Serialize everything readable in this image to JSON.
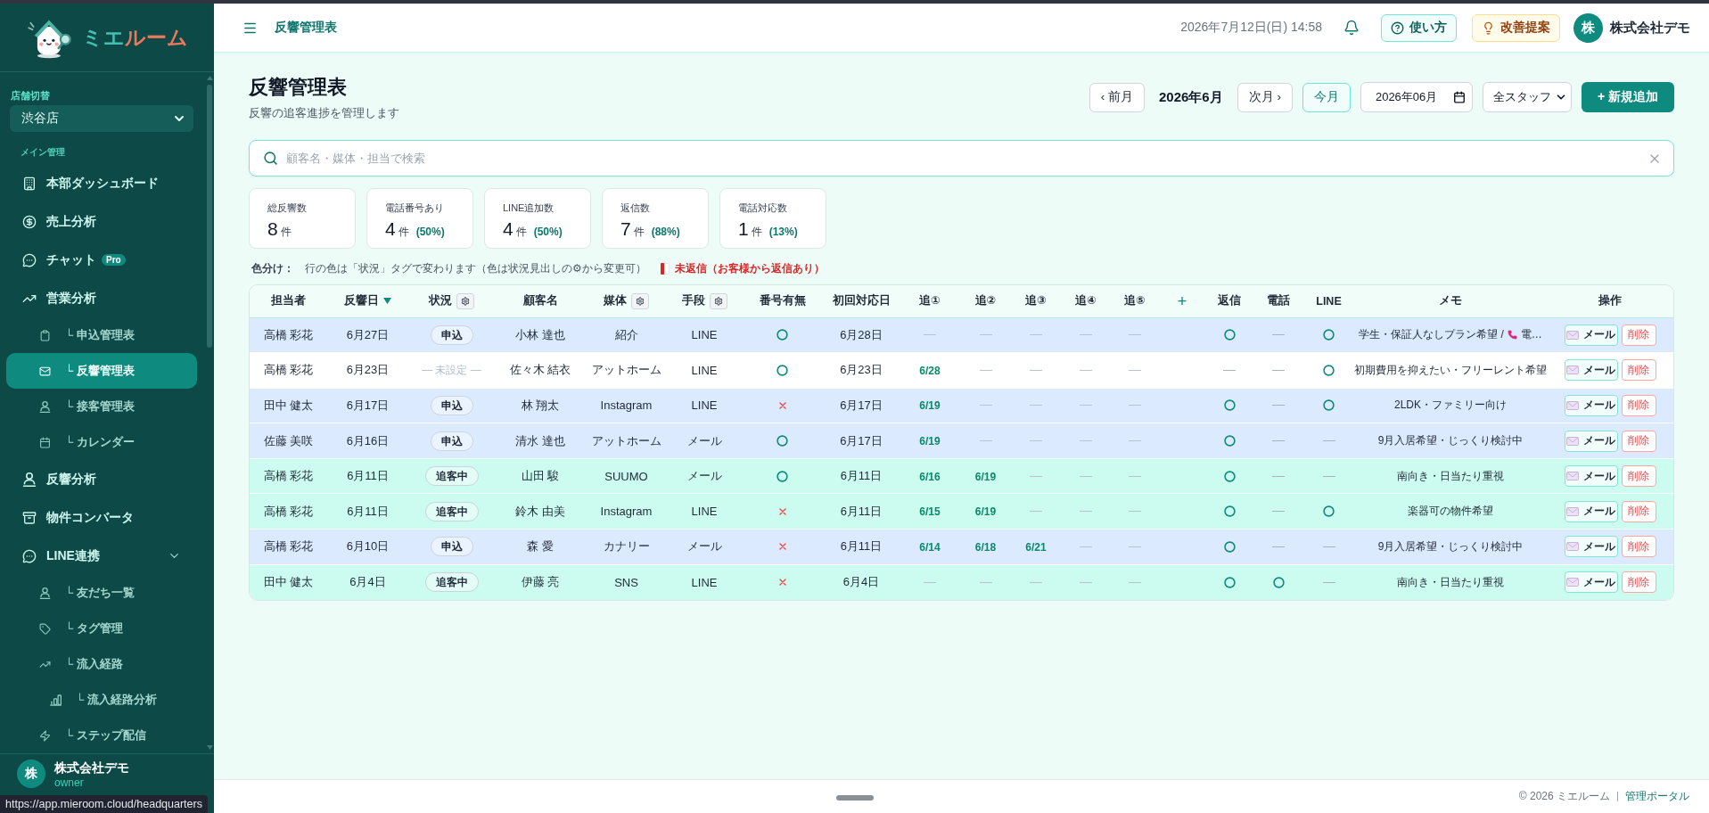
{
  "sidebar": {
    "logo": {
      "primary": "ミエ",
      "accent": "ルーム"
    },
    "store_switch": {
      "label": "店舗切替",
      "value": "渋谷店"
    },
    "section_label": "メイン管理",
    "items": [
      {
        "label": "本部ダッシュボード",
        "selected": false
      },
      {
        "label": "売上分析",
        "selected": false
      },
      {
        "label": "チャット",
        "badge": "Pro",
        "selected": false
      },
      {
        "label": "営業分析",
        "selected": false,
        "children": [
          {
            "label": "└ 申込管理表",
            "selected": false
          },
          {
            "label": "└ 反響管理表",
            "selected": true
          },
          {
            "label": "└ 接客管理表",
            "selected": false
          },
          {
            "label": "└ カレンダー",
            "selected": false
          }
        ]
      },
      {
        "label": "反響分析",
        "selected": false
      },
      {
        "label": "物件コンバータ",
        "selected": false
      },
      {
        "label": "LINE連携",
        "selected": false,
        "expanded": true,
        "children": [
          {
            "label": "└ 友だち一覧",
            "selected": false
          },
          {
            "label": "└ タグ管理",
            "selected": false
          },
          {
            "label": "└ 流入経路",
            "selected": false,
            "children": [
              {
                "label": "└ 流入経路分析",
                "selected": false
              }
            ]
          },
          {
            "label": "└ ステップ配信",
            "selected": false
          }
        ]
      }
    ],
    "user": {
      "avatar": "株",
      "name": "株式会社デモ",
      "role": "owner"
    }
  },
  "link_preview": "https://app.mieroom.cloud/headquarters",
  "header": {
    "title": "反響管理表",
    "datetime": "2026年7月12日(日) 14:58",
    "help_button": "使い方",
    "feedback_button": "改善提案",
    "account": {
      "avatar": "株",
      "name": "株式会社デモ"
    }
  },
  "page": {
    "title": "反響管理表",
    "subtitle": "反響の追客進捗を管理します",
    "prev_button": "‹ 前月",
    "current_month": "2026年6月",
    "next_button": "次月 ›",
    "today_button": "今月",
    "month_field": {
      "value": "2026年06月"
    },
    "staff_select": {
      "value": "全スタッフ"
    },
    "add_button": "+ 新規追加"
  },
  "search": {
    "placeholder": "顧客名・媒体・担当で検索"
  },
  "stats": [
    {
      "label": "総反響数",
      "value": "8",
      "unit": "件"
    },
    {
      "label": "電話番号あり",
      "value": "4",
      "unit": "件",
      "share": "(50%)"
    },
    {
      "label": "LINE追加数",
      "value": "4",
      "unit": "件",
      "share": "(50%)"
    },
    {
      "label": "返信数",
      "value": "7",
      "unit": "件",
      "share": "(88%)"
    },
    {
      "label": "電話対応数",
      "value": "1",
      "unit": "件",
      "share": "(13%)"
    }
  ],
  "legend": {
    "label": "色分け：",
    "text": "行の色は「状況」タグで変わります（色は状況見出しの⚙から変更可）",
    "unreplied": "未返信（お客様から返信あり）"
  },
  "table": {
    "columns": [
      {
        "label": "担当者",
        "kind": "label",
        "sorted": false
      },
      {
        "label": "反響日",
        "kind": "label",
        "sorted": true
      },
      {
        "label": "状況",
        "kind": "label",
        "sorted": false,
        "settings_button": true
      },
      {
        "label": "顧客名",
        "kind": "label",
        "sorted": false
      },
      {
        "label": "媒体",
        "kind": "label",
        "sorted": false,
        "settings_button": true
      },
      {
        "label": "手段",
        "kind": "label",
        "sorted": false,
        "settings_button": true
      },
      {
        "label": "番号有無",
        "kind": "label",
        "sorted": false
      },
      {
        "label": "初回対応日",
        "kind": "label",
        "sorted": false
      },
      {
        "label": "追①",
        "kind": "label",
        "sorted": false
      },
      {
        "label": "追②",
        "kind": "label",
        "sorted": false
      },
      {
        "label": "追③",
        "kind": "label",
        "sorted": false
      },
      {
        "label": "追④",
        "kind": "label",
        "sorted": false
      },
      {
        "label": "追⑤",
        "kind": "label",
        "sorted": false
      },
      {
        "label": "+",
        "kind": "add",
        "sorted": false
      },
      {
        "label": "返信",
        "kind": "label",
        "sorted": false
      },
      {
        "label": "電話",
        "kind": "label",
        "sorted": false
      },
      {
        "label": "LINE",
        "kind": "label",
        "sorted": false
      },
      {
        "label": "メモ",
        "kind": "label",
        "sorted": false
      },
      {
        "label": "操作",
        "kind": "label",
        "sorted": false
      }
    ],
    "rows": [
      {
        "staff": "高橋 彩花",
        "date": "6月27日",
        "status": {
          "kind": "applied",
          "text": "申込"
        },
        "customer": "小林 達也",
        "media": "紹介",
        "method": "LINE",
        "has_number": true,
        "first_response": "6月28日",
        "follow_ups": [],
        "replied": true,
        "phone": false,
        "line": true,
        "memo": "学生・保証人なしプラン希望 /",
        "memo_phone": "電…",
        "mail_button": "メール",
        "delete_button": "削除"
      },
      {
        "staff": "高橋 彩花",
        "date": "6月23日",
        "status": {
          "kind": "unset",
          "text": "— 未設定 —"
        },
        "customer": "佐々木 結衣",
        "media": "アットホーム",
        "method": "LINE",
        "has_number": true,
        "first_response": "6月23日",
        "follow_ups": [
          "6/28"
        ],
        "replied": false,
        "phone": false,
        "line": true,
        "memo": "初期費用を抑えたい・フリーレント希望",
        "mail_button": "メール",
        "delete_button": "削除"
      },
      {
        "staff": "田中 健太",
        "date": "6月17日",
        "status": {
          "kind": "applied",
          "text": "申込"
        },
        "customer": "林 翔太",
        "media": "Instagram",
        "method": "LINE",
        "has_number": false,
        "first_response": "6月17日",
        "follow_ups": [
          "6/19"
        ],
        "replied": true,
        "phone": false,
        "line": true,
        "memo": "2LDK・ファミリー向け",
        "mail_button": "メール",
        "delete_button": "削除"
      },
      {
        "staff": "佐藤 美咲",
        "date": "6月16日",
        "status": {
          "kind": "applied",
          "text": "申込"
        },
        "customer": "清水 達也",
        "media": "アットホーム",
        "method": "メール",
        "has_number": true,
        "first_response": "6月17日",
        "follow_ups": [
          "6/19"
        ],
        "replied": true,
        "phone": false,
        "line": false,
        "memo": "9月入居希望・じっくり検討中",
        "mail_button": "メール",
        "delete_button": "削除"
      },
      {
        "staff": "高橋 彩花",
        "date": "6月11日",
        "status": {
          "kind": "following",
          "text": "追客中"
        },
        "customer": "山田 駿",
        "media": "SUUMO",
        "method": "メール",
        "has_number": true,
        "first_response": "6月11日",
        "follow_ups": [
          "6/16",
          "6/19"
        ],
        "replied": true,
        "phone": false,
        "line": false,
        "memo": "南向き・日当たり重視",
        "mail_button": "メール",
        "delete_button": "削除"
      },
      {
        "staff": "高橋 彩花",
        "date": "6月11日",
        "status": {
          "kind": "following",
          "text": "追客中"
        },
        "customer": "鈴木 由美",
        "media": "Instagram",
        "method": "LINE",
        "has_number": false,
        "first_response": "6月11日",
        "follow_ups": [
          "6/15",
          "6/19"
        ],
        "replied": true,
        "phone": false,
        "line": true,
        "memo": "楽器可の物件希望",
        "mail_button": "メール",
        "delete_button": "削除"
      },
      {
        "staff": "高橋 彩花",
        "date": "6月10日",
        "status": {
          "kind": "applied",
          "text": "申込"
        },
        "customer": "森 愛",
        "media": "カナリー",
        "method": "メール",
        "has_number": false,
        "first_response": "6月11日",
        "follow_ups": [
          "6/14",
          "6/18",
          "6/21"
        ],
        "replied": true,
        "phone": false,
        "line": false,
        "memo": "9月入居希望・じっくり検討中",
        "mail_button": "メール",
        "delete_button": "削除"
      },
      {
        "staff": "田中 健太",
        "date": "6月4日",
        "status": {
          "kind": "following",
          "text": "追客中"
        },
        "customer": "伊藤 亮",
        "media": "SNS",
        "method": "LINE",
        "has_number": false,
        "first_response": "6月4日",
        "follow_ups": [],
        "replied": true,
        "phone": true,
        "line": false,
        "memo": "南向き・日当たり重視",
        "mail_button": "メール",
        "delete_button": "削除"
      }
    ]
  },
  "footer": {
    "copyright": "© 2026 ミエルーム",
    "link": "管理ポータル"
  }
}
